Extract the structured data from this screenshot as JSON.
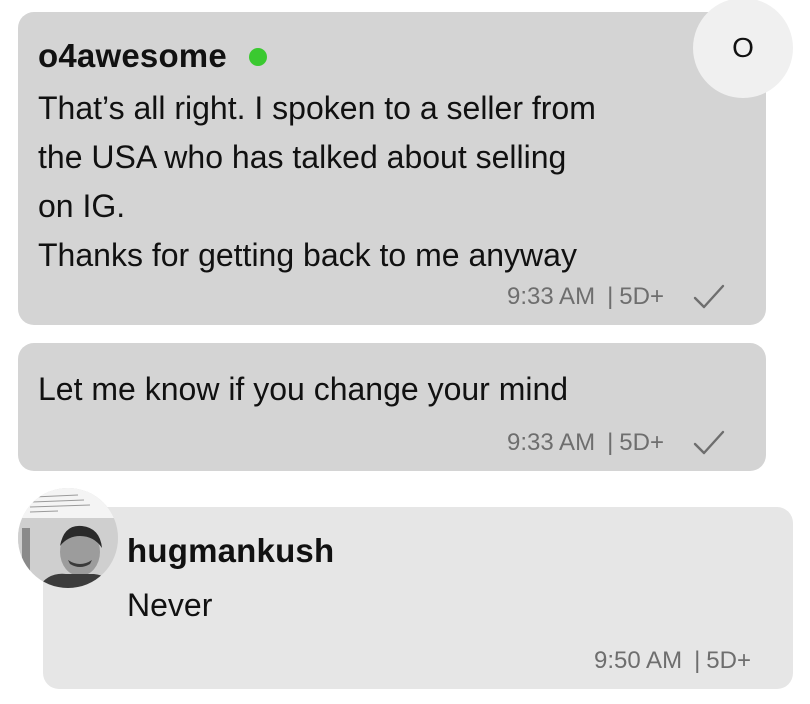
{
  "messages": [
    {
      "sender": "o4awesome",
      "online": true,
      "text": "That’s all right. I spoken to a seller from\nthe USA who has talked about selling\non IG.\nThanks for getting back to me anyway",
      "time": "9:33 AM",
      "age": "5D+",
      "sent_check": true
    },
    {
      "text": "Let me know if you change your mind",
      "time": "9:33 AM",
      "age": "5D+",
      "sent_check": true
    },
    {
      "sender": "hugmankush",
      "text": "Never",
      "time": "9:50 AM",
      "age": "5D+"
    }
  ],
  "avatars": {
    "own_initial": "O",
    "other_icon": "profile-photo"
  },
  "meta_separator": "|",
  "colors": {
    "own_bubble": "#d4d4d4",
    "other_bubble": "#e6e6e6",
    "online_dot": "#3ac930",
    "meta_text": "#6e6e6e"
  }
}
